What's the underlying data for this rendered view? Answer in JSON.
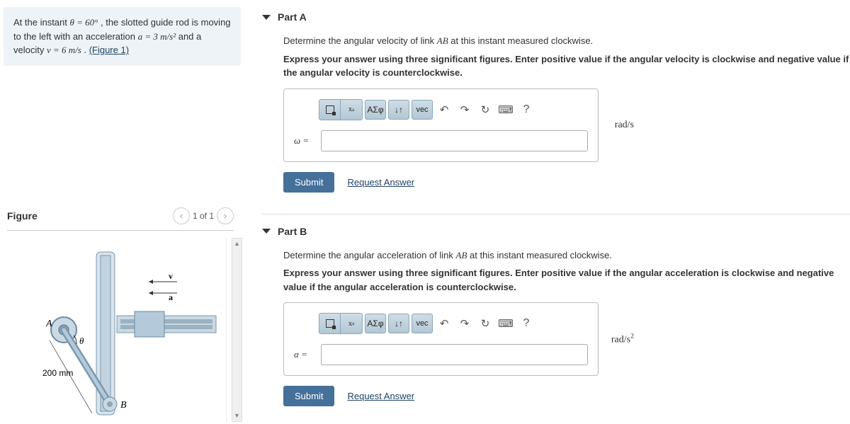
{
  "problem": {
    "text_prefix": "At the instant ",
    "theta": "θ = 60°",
    "text_mid1": " , the slotted guide rod is moving to the left with an acceleration ",
    "accel": "a = 3  m/s²",
    "text_mid2": " and a velocity ",
    "vel": "v = 6  m/s",
    "text_end": " . ",
    "figlink": "(Figure 1)"
  },
  "figure": {
    "title": "Figure",
    "count": "1 of 1",
    "labels": {
      "v": "v",
      "a": "a",
      "A": "A",
      "B": "B",
      "theta": "θ",
      "length": "200 mm"
    }
  },
  "partA": {
    "title": "Part A",
    "question_pre": "Determine the angular velocity of link ",
    "link": "AB",
    "question_post": " at this instant measured clockwise.",
    "instruction": "Express your answer using three significant figures. Enter positive value if the angular velocity is clockwise and negative value if the angular velocity is counterclockwise.",
    "var_label": "ω =",
    "unit": "rad/s",
    "submit": "Submit",
    "request": "Request Answer",
    "toolbar": {
      "greek": "ΑΣφ",
      "arrows": "↓↑",
      "vec": "vec",
      "help": "?"
    }
  },
  "partB": {
    "title": "Part B",
    "question_pre": "Determine the angular acceleration of link ",
    "link": "AB",
    "question_post": " at this instant measured clockwise.",
    "instruction": "Express your answer using three significant figures. Enter positive value if the angular acceleration is clockwise and negative value if the angular acceleration is counterclockwise.",
    "var_label": "α =",
    "unit_html": "rad/s",
    "submit": "Submit",
    "request": "Request Answer"
  }
}
